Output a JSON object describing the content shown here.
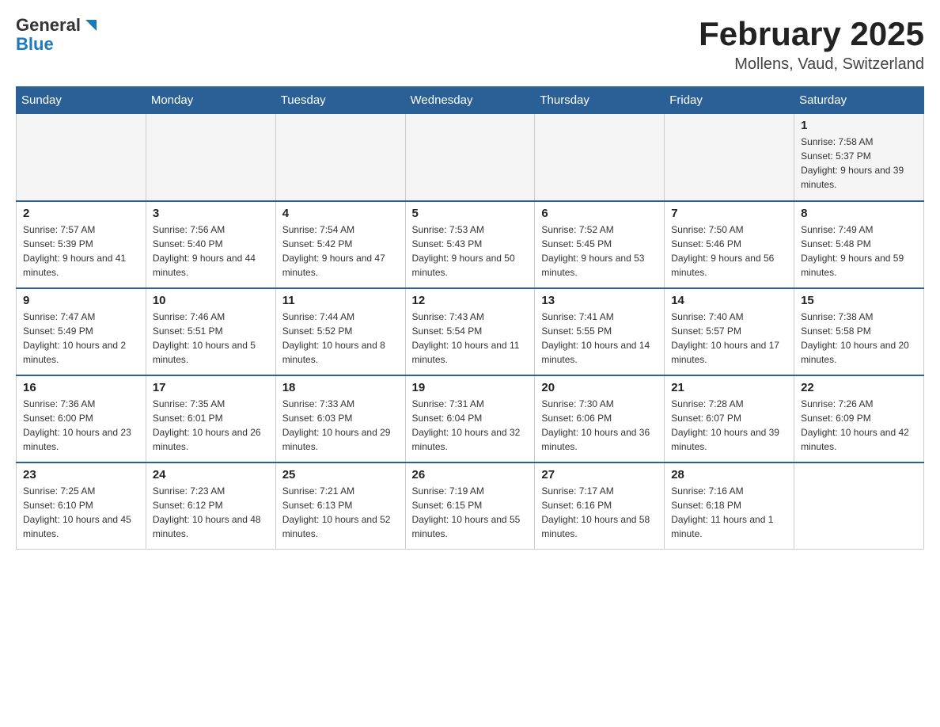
{
  "header": {
    "logo": {
      "general": "General",
      "blue": "Blue"
    },
    "title": "February 2025",
    "location": "Mollens, Vaud, Switzerland"
  },
  "weekdays": [
    "Sunday",
    "Monday",
    "Tuesday",
    "Wednesday",
    "Thursday",
    "Friday",
    "Saturday"
  ],
  "weeks": [
    [
      {
        "day": "",
        "info": ""
      },
      {
        "day": "",
        "info": ""
      },
      {
        "day": "",
        "info": ""
      },
      {
        "day": "",
        "info": ""
      },
      {
        "day": "",
        "info": ""
      },
      {
        "day": "",
        "info": ""
      },
      {
        "day": "1",
        "info": "Sunrise: 7:58 AM\nSunset: 5:37 PM\nDaylight: 9 hours and 39 minutes."
      }
    ],
    [
      {
        "day": "2",
        "info": "Sunrise: 7:57 AM\nSunset: 5:39 PM\nDaylight: 9 hours and 41 minutes."
      },
      {
        "day": "3",
        "info": "Sunrise: 7:56 AM\nSunset: 5:40 PM\nDaylight: 9 hours and 44 minutes."
      },
      {
        "day": "4",
        "info": "Sunrise: 7:54 AM\nSunset: 5:42 PM\nDaylight: 9 hours and 47 minutes."
      },
      {
        "day": "5",
        "info": "Sunrise: 7:53 AM\nSunset: 5:43 PM\nDaylight: 9 hours and 50 minutes."
      },
      {
        "day": "6",
        "info": "Sunrise: 7:52 AM\nSunset: 5:45 PM\nDaylight: 9 hours and 53 minutes."
      },
      {
        "day": "7",
        "info": "Sunrise: 7:50 AM\nSunset: 5:46 PM\nDaylight: 9 hours and 56 minutes."
      },
      {
        "day": "8",
        "info": "Sunrise: 7:49 AM\nSunset: 5:48 PM\nDaylight: 9 hours and 59 minutes."
      }
    ],
    [
      {
        "day": "9",
        "info": "Sunrise: 7:47 AM\nSunset: 5:49 PM\nDaylight: 10 hours and 2 minutes."
      },
      {
        "day": "10",
        "info": "Sunrise: 7:46 AM\nSunset: 5:51 PM\nDaylight: 10 hours and 5 minutes."
      },
      {
        "day": "11",
        "info": "Sunrise: 7:44 AM\nSunset: 5:52 PM\nDaylight: 10 hours and 8 minutes."
      },
      {
        "day": "12",
        "info": "Sunrise: 7:43 AM\nSunset: 5:54 PM\nDaylight: 10 hours and 11 minutes."
      },
      {
        "day": "13",
        "info": "Sunrise: 7:41 AM\nSunset: 5:55 PM\nDaylight: 10 hours and 14 minutes."
      },
      {
        "day": "14",
        "info": "Sunrise: 7:40 AM\nSunset: 5:57 PM\nDaylight: 10 hours and 17 minutes."
      },
      {
        "day": "15",
        "info": "Sunrise: 7:38 AM\nSunset: 5:58 PM\nDaylight: 10 hours and 20 minutes."
      }
    ],
    [
      {
        "day": "16",
        "info": "Sunrise: 7:36 AM\nSunset: 6:00 PM\nDaylight: 10 hours and 23 minutes."
      },
      {
        "day": "17",
        "info": "Sunrise: 7:35 AM\nSunset: 6:01 PM\nDaylight: 10 hours and 26 minutes."
      },
      {
        "day": "18",
        "info": "Sunrise: 7:33 AM\nSunset: 6:03 PM\nDaylight: 10 hours and 29 minutes."
      },
      {
        "day": "19",
        "info": "Sunrise: 7:31 AM\nSunset: 6:04 PM\nDaylight: 10 hours and 32 minutes."
      },
      {
        "day": "20",
        "info": "Sunrise: 7:30 AM\nSunset: 6:06 PM\nDaylight: 10 hours and 36 minutes."
      },
      {
        "day": "21",
        "info": "Sunrise: 7:28 AM\nSunset: 6:07 PM\nDaylight: 10 hours and 39 minutes."
      },
      {
        "day": "22",
        "info": "Sunrise: 7:26 AM\nSunset: 6:09 PM\nDaylight: 10 hours and 42 minutes."
      }
    ],
    [
      {
        "day": "23",
        "info": "Sunrise: 7:25 AM\nSunset: 6:10 PM\nDaylight: 10 hours and 45 minutes."
      },
      {
        "day": "24",
        "info": "Sunrise: 7:23 AM\nSunset: 6:12 PM\nDaylight: 10 hours and 48 minutes."
      },
      {
        "day": "25",
        "info": "Sunrise: 7:21 AM\nSunset: 6:13 PM\nDaylight: 10 hours and 52 minutes."
      },
      {
        "day": "26",
        "info": "Sunrise: 7:19 AM\nSunset: 6:15 PM\nDaylight: 10 hours and 55 minutes."
      },
      {
        "day": "27",
        "info": "Sunrise: 7:17 AM\nSunset: 6:16 PM\nDaylight: 10 hours and 58 minutes."
      },
      {
        "day": "28",
        "info": "Sunrise: 7:16 AM\nSunset: 6:18 PM\nDaylight: 11 hours and 1 minute."
      },
      {
        "day": "",
        "info": ""
      }
    ]
  ]
}
